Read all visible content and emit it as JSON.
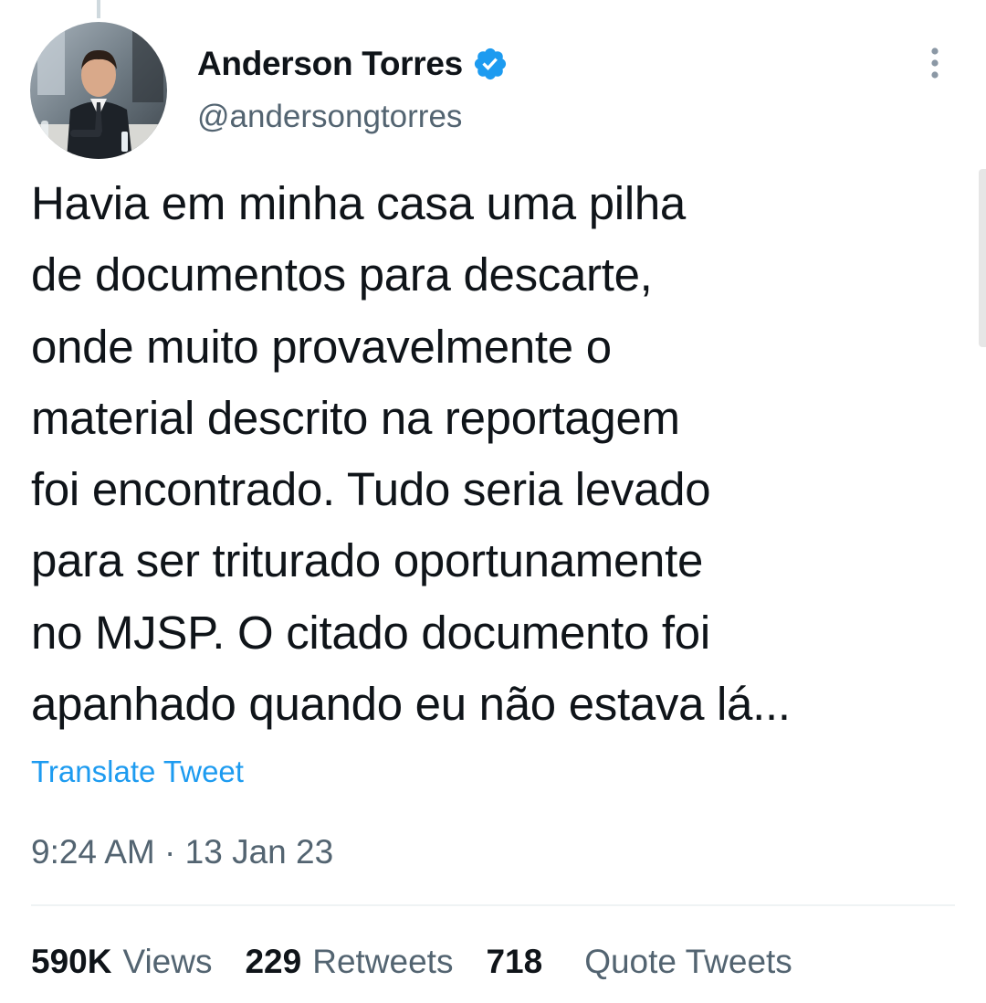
{
  "author": {
    "display_name": "Anderson Torres",
    "handle": "@andersongtorres",
    "verified": true
  },
  "tweet": {
    "lines": [
      "Havia em minha casa uma pilha",
      "de documentos para descarte,",
      "onde muito provavelmente o",
      "material descrito na reportagem",
      "foi encontrado. Tudo seria levado",
      "para ser triturado oportunamente",
      "no MJSP. O citado documento foi",
      "apanhado quando eu não estava lá..."
    ],
    "translate_label": "Translate Tweet",
    "timestamp": "9:24 AM · 13 Jan 23"
  },
  "stats": {
    "views_count": "590K",
    "views_label": "Views",
    "retweets_count": "229",
    "retweets_label": "Retweets",
    "quotes_count": "718",
    "quotes_label": "Quote Tweets"
  },
  "icons": {
    "verified": "verified-badge-icon",
    "more": "more-vertical-icon"
  },
  "colors": {
    "accent": "#1d9bf0",
    "text_primary": "#0f1419",
    "text_secondary": "#536471",
    "divider": "#eff3f4"
  }
}
